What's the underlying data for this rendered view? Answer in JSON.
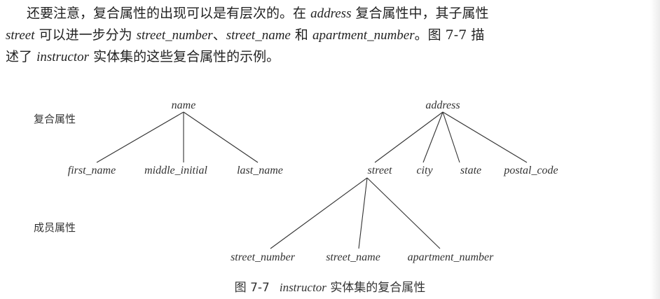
{
  "paragraph": {
    "line1": {
      "text_a": "还要注意，复合属性的出现可以是有层次的。在",
      "term_address": "address",
      "text_b": "复合属性中，其子属性"
    },
    "line2": {
      "term_street": "street",
      "text_a": "可以进一步分为",
      "term_street_number": "street_number",
      "sep1": "、",
      "term_street_name": "street_name",
      "text_and": "和",
      "term_apartment_number": "apartment_number",
      "text_b": "。图 7-7 描"
    },
    "line3": {
      "text_a": "述了",
      "term_instructor": "instructor",
      "text_b": "实体集的这些复合属性的示例。"
    }
  },
  "figure": {
    "label_composite": "复合属性",
    "label_component": "成员属性",
    "tree_name": {
      "root": "name",
      "children": [
        "first_name",
        "middle_initial",
        "last_name"
      ]
    },
    "tree_address": {
      "root": "address",
      "children": [
        "street",
        "city",
        "state",
        "postal_code"
      ]
    },
    "tree_street": {
      "children": [
        "street_number",
        "street_name",
        "apartment_number"
      ]
    }
  },
  "caption": {
    "number": "图 7-7",
    "term": "instructor",
    "text": "实体集的复合属性"
  }
}
